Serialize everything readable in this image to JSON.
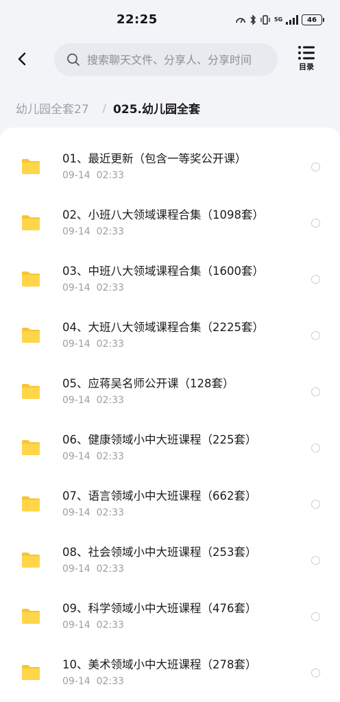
{
  "status_bar": {
    "time": "22:25",
    "battery": "46",
    "network": "5G"
  },
  "search": {
    "placeholder": "搜索聊天文件、分享人、分享时间"
  },
  "toolbar": {
    "catalog_label": "目录"
  },
  "breadcrumb": {
    "parent": "幼儿园全套27",
    "separator": "/",
    "current": "025.幼儿园全套"
  },
  "colors": {
    "folder": "#ffd54a",
    "folder_tab": "#f7c531",
    "background": "#f3f4f7"
  },
  "files": [
    {
      "name": "01、最近更新（包含一等奖公开课）",
      "date": "09-14",
      "time": "02:33"
    },
    {
      "name": "02、小班八大领域课程合集（1098套）",
      "date": "09-14",
      "time": "02:33"
    },
    {
      "name": "03、中班八大领域课程合集（1600套）",
      "date": "09-14",
      "time": "02:33"
    },
    {
      "name": "04、大班八大领域课程合集（2225套）",
      "date": "09-14",
      "time": "02:33"
    },
    {
      "name": "05、应蒋吴名师公开课（128套）",
      "date": "09-14",
      "time": "02:33"
    },
    {
      "name": "06、健康领域小中大班课程（225套）",
      "date": "09-14",
      "time": "02:33"
    },
    {
      "name": "07、语言领域小中大班课程（662套）",
      "date": "09-14",
      "time": "02:33"
    },
    {
      "name": "08、社会领域小中大班课程（253套）",
      "date": "09-14",
      "time": "02:33"
    },
    {
      "name": "09、科学领域小中大班课程（476套）",
      "date": "09-14",
      "time": "02:33"
    },
    {
      "name": "10、美术领域小中大班课程（278套）",
      "date": "09-14",
      "time": "02:33"
    }
  ]
}
